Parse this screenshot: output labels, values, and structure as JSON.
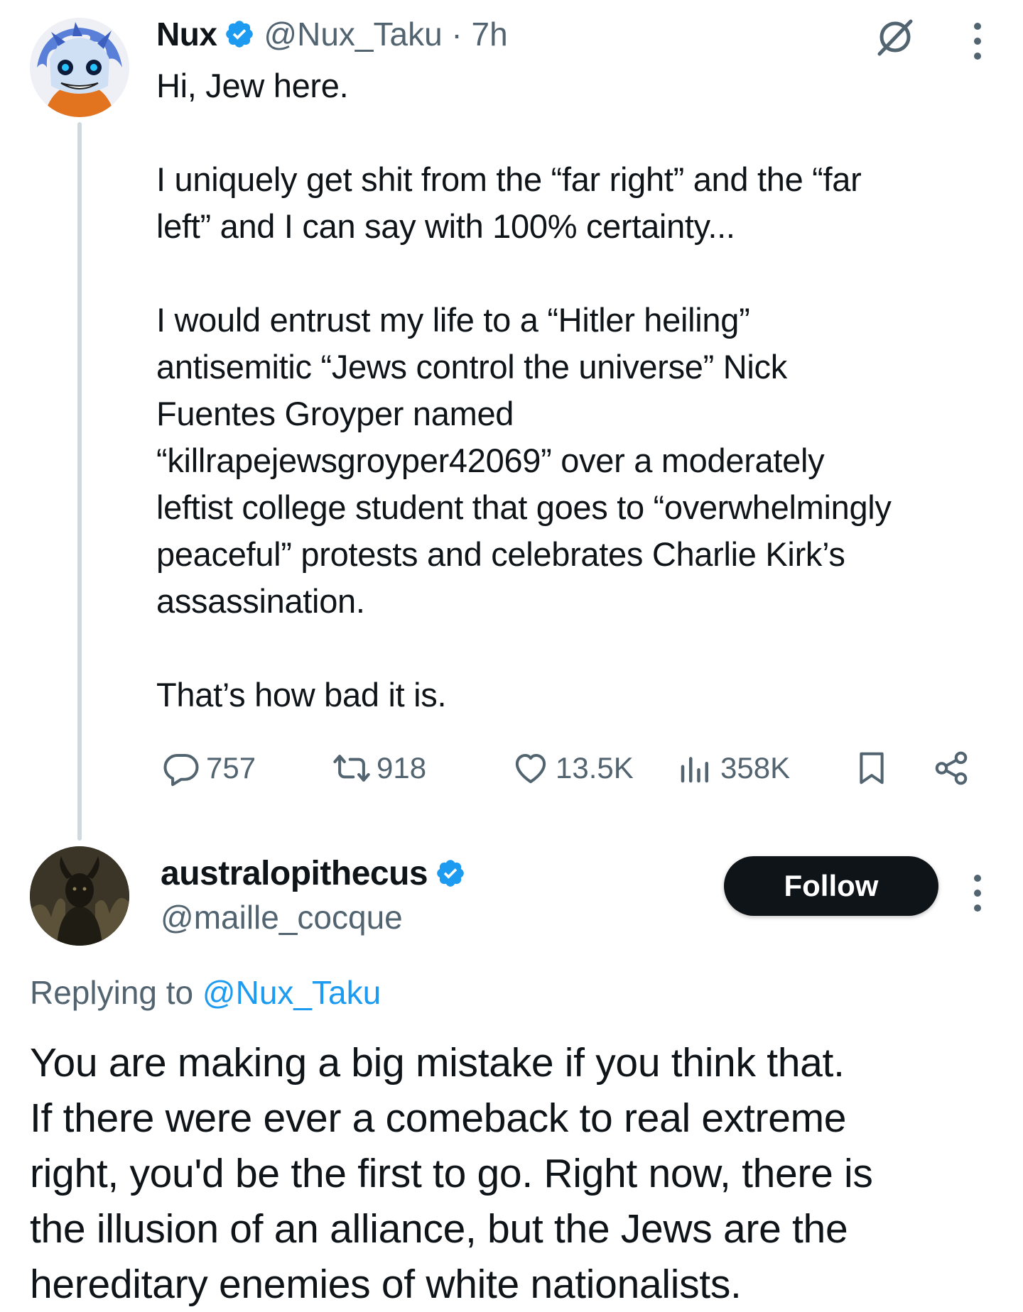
{
  "tweet": {
    "author_name": "Nux",
    "handle_time": "@Nux_Taku · 7h",
    "text_lines": [
      "Hi, Jew here.",
      "",
      "I uniquely get shit from the “far right” and the “far",
      "left” and I can say with 100% certainty...",
      "",
      "I would entrust my life to a “Hitler heiling”",
      "antisemitic “Jews control the universe” Nick",
      "Fuentes Groyper named",
      "“killrapejewsgroyper42069” over a moderately",
      "leftist college student that goes to “overwhelmingly",
      "peaceful” protests and celebrates Charlie Kirk’s",
      "assassination.",
      "",
      "That’s how bad it is."
    ],
    "stats": {
      "replies": "757",
      "reposts": "918",
      "likes": "13.5K",
      "views": "358K"
    },
    "icons": {
      "verified": "verified-badge-icon",
      "grok": "grok-icon",
      "more": "more-icon",
      "reply": "reply-icon",
      "repost": "repost-icon",
      "like": "heart-icon",
      "views": "views-icon",
      "bookmark": "bookmark-icon",
      "share": "share-icon"
    }
  },
  "reply": {
    "author_name": "australopithecus",
    "handle": "@maille_cocque",
    "follow_label": "Follow",
    "replying_prefix": "Replying to ",
    "replying_handle": "@Nux_Taku",
    "text_lines": [
      "You are making a big mistake if you think that.",
      "If there were ever a comeback to real extreme",
      "right, you'd be the first to go. Right now, there is",
      "the illusion of an alliance, but the Jews are the",
      "hereditary enemies of white nationalists."
    ]
  },
  "colors": {
    "text": "#0f1419",
    "secondary": "#536471",
    "link": "#1d9bf0",
    "verified": "#1d9bf0",
    "thread_line": "#cfd9de",
    "follow_bg": "#0f1419"
  }
}
